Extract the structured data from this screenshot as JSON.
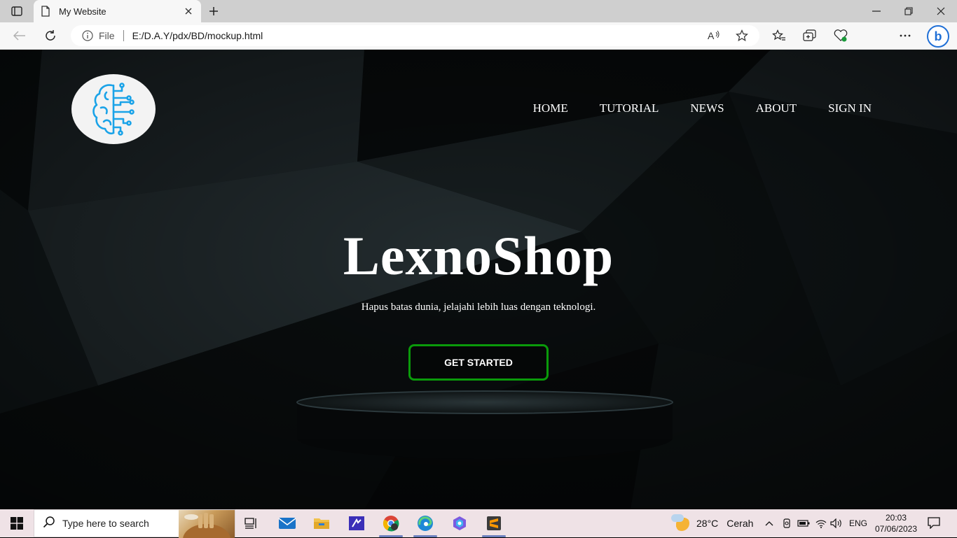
{
  "browser": {
    "tab_title": "My Website",
    "address_scheme_label": "File",
    "url": "E:/D.A.Y/pdx/BD/mockup.html"
  },
  "site": {
    "nav": [
      "HOME",
      "TUTORIAL",
      "NEWS",
      "ABOUT",
      "SIGN IN"
    ],
    "headline": "LexnoShop",
    "tagline": "Hapus batas dunia, jelajahi lebih luas dengan teknologi.",
    "cta_label": "GET STARTED",
    "accent_color": "#0a9a0a",
    "logo_color": "#1aa3e8",
    "logo_icon": "brain-circuit-icon"
  },
  "taskbar": {
    "search_placeholder": "Type here to search",
    "weather_temp": "28°C",
    "weather_condition": "Cerah",
    "language": "ENG",
    "time": "20:03",
    "date": "07/06/2023",
    "apps": [
      "task-view",
      "mail",
      "file-explorer",
      "visual-studio",
      "chrome",
      "edge",
      "copilot",
      "sublime-text"
    ]
  }
}
